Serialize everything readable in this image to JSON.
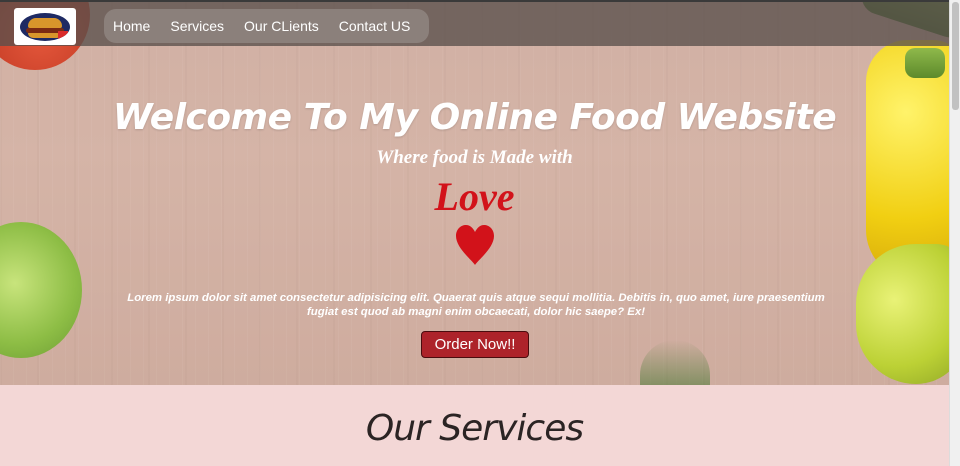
{
  "nav": {
    "logo_icon": "burger-logo-icon",
    "links": [
      "Home",
      "Services",
      "Our CLients",
      "Contact US"
    ]
  },
  "hero": {
    "title": "Welcome To My Online Food Website",
    "subtitle": "Where food is Made with",
    "love": "Love",
    "heart_icon": "heart-icon",
    "paragraph": "Lorem ipsum dolor sit amet consectetur adipisicing elit. Quaerat quis atque sequi mollitia. Debitis in, quo amet, iure praesentium fugiat est quod ab magni enim obcaecati, dolor hic saepe? Ex!",
    "button": "Order Now!!"
  },
  "services": {
    "title": "Our Services"
  },
  "colors": {
    "accent_red": "#d2121a",
    "button_bg": "#ad232a",
    "section_bg": "#f3d7d6"
  }
}
